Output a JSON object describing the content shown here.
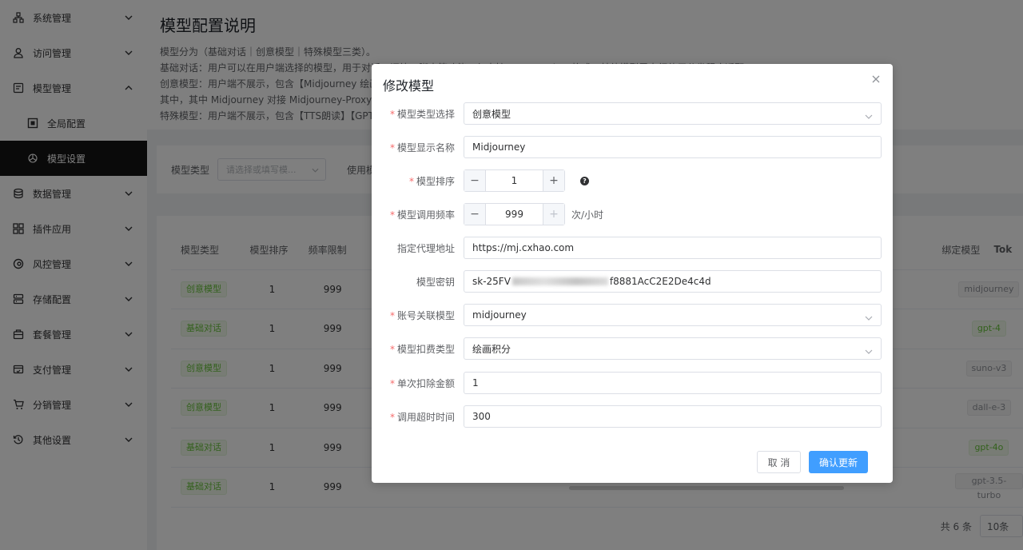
{
  "sidebar": {
    "items": [
      {
        "label": "系统管理",
        "icon": "network-icon"
      },
      {
        "label": "访问管理",
        "icon": "user-icon"
      },
      {
        "label": "模型管理",
        "icon": "model-icon"
      },
      {
        "label": "全局配置",
        "icon": "chip-icon"
      },
      {
        "label": "模型设置",
        "icon": "openai-icon"
      },
      {
        "label": "数据管理",
        "icon": "database-icon"
      },
      {
        "label": "插件应用",
        "icon": "grid-icon"
      },
      {
        "label": "风控管理",
        "icon": "shield-icon"
      },
      {
        "label": "存储配置",
        "icon": "storage-icon"
      },
      {
        "label": "套餐管理",
        "icon": "bag-icon"
      },
      {
        "label": "支付管理",
        "icon": "wallet-icon"
      },
      {
        "label": "分销管理",
        "icon": "cart-icon"
      },
      {
        "label": "其他设置",
        "icon": "history-icon"
      }
    ]
  },
  "intro": {
    "title": "模型配置说明",
    "lines": [
      "模型分为（基础对话｜创意模型｜特殊模型三类）。",
      "基础对话：用户可以在用户端选择的模型，用于对话、问答、脚本等功能，仅支持 OpenAI Chat 格式，其他模型需自行使用分发程序适配",
      "创意模型：用户端不展示，包含【Midjourney 绘画",
      "其中，其中 Midjourney 对接 Midjourney-Proxy-",
      "特殊模型：用户端不展示，包含【TTS朗读】【GPT"
    ]
  },
  "filter": {
    "label": "模型类型",
    "placeholder": "请选择或填写模...",
    "label2": "使用模"
  },
  "table": {
    "headers": [
      "模型类型",
      "模型排序",
      "频率限制",
      "绑定模型",
      "Tok"
    ],
    "rows": [
      {
        "type": "创意模型",
        "order": "1",
        "rate": "999",
        "bind": "midjourney"
      },
      {
        "type": "基础对话",
        "order": "1",
        "rate": "999",
        "bind": "gpt-4"
      },
      {
        "type": "创意模型",
        "order": "1",
        "rate": "999",
        "bind": "suno-v3"
      },
      {
        "type": "创意模型",
        "order": "1",
        "rate": "999",
        "bind": "dall-e-3"
      },
      {
        "type": "基础对话",
        "order": "1",
        "rate": "999",
        "bind": "gpt-4o"
      },
      {
        "type": "基础对话",
        "order": "1",
        "rate": "999",
        "bind": "gpt-3.5-turbo"
      }
    ],
    "total": "共 6 条",
    "page_size": "10条"
  },
  "dialog": {
    "title": "修改模型",
    "fields": {
      "type": {
        "label": "模型类型选择",
        "value": "创意模型"
      },
      "name": {
        "label": "模型显示名称",
        "value": "Midjourney"
      },
      "order": {
        "label": "模型排序",
        "value": "1"
      },
      "rate": {
        "label": "模型调用频率",
        "value": "999",
        "unit": "次/小时"
      },
      "proxy": {
        "label": "指定代理地址",
        "value": "https://mj.cxhao.com"
      },
      "key": {
        "label": "模型密钥",
        "prefix": "sk-25FV",
        "suffix": "f8881AcC2E2De4c4d"
      },
      "bind": {
        "label": "账号关联模型",
        "value": "midjourney"
      },
      "deduct_type": {
        "label": "模型扣费类型",
        "value": "绘画积分"
      },
      "deduct_amount": {
        "label": "单次扣除金额",
        "value": "1"
      },
      "timeout": {
        "label": "调用超时时间",
        "value": "300"
      }
    },
    "cancel": "取 消",
    "confirm": "确认更新"
  },
  "colors": {
    "primary": "#409eff",
    "required": "#f56c6c",
    "tag_green": "#67c23a"
  }
}
